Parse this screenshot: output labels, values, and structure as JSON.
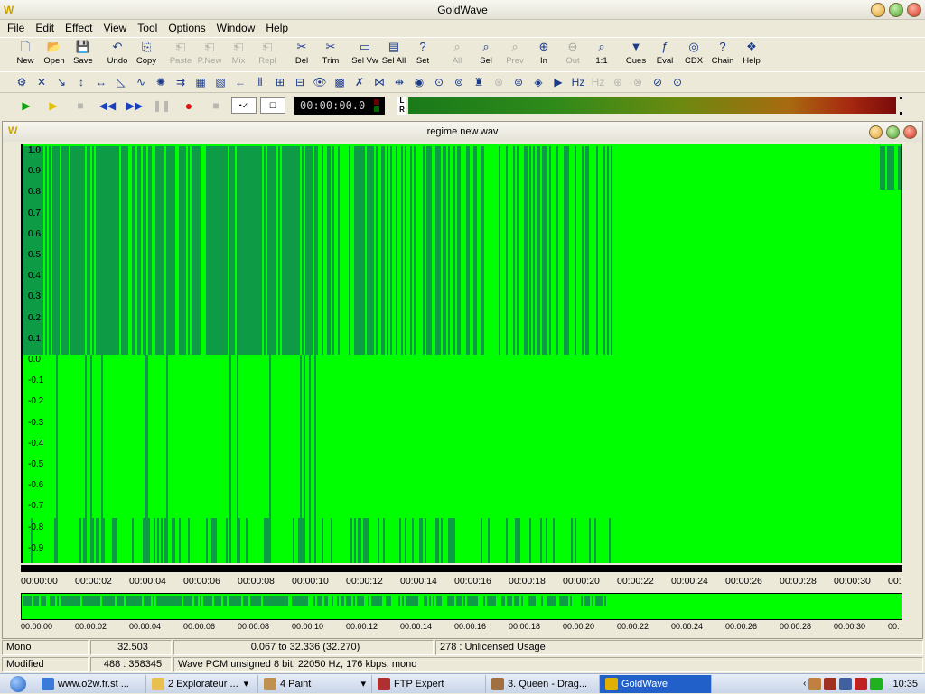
{
  "window": {
    "title": "GoldWave"
  },
  "menu": [
    "File",
    "Edit",
    "Effect",
    "View",
    "Tool",
    "Options",
    "Window",
    "Help"
  ],
  "toolbar": [
    {
      "label": "New",
      "icon": "new-icon",
      "enabled": true
    },
    {
      "label": "Open",
      "icon": "open-icon",
      "enabled": true
    },
    {
      "label": "Save",
      "icon": "save-icon",
      "enabled": true
    },
    {
      "label": "Undo",
      "icon": "undo-icon",
      "enabled": true
    },
    {
      "label": "Copy",
      "icon": "copy-icon",
      "enabled": true
    },
    {
      "label": "Paste",
      "icon": "paste-icon",
      "enabled": false
    },
    {
      "label": "P.New",
      "icon": "paste-new-icon",
      "enabled": false
    },
    {
      "label": "Mix",
      "icon": "mix-icon",
      "enabled": false
    },
    {
      "label": "Repl",
      "icon": "replace-icon",
      "enabled": false
    },
    {
      "label": "Del",
      "icon": "delete-icon",
      "enabled": true
    },
    {
      "label": "Trim",
      "icon": "trim-icon",
      "enabled": true
    },
    {
      "label": "Sel Vw",
      "icon": "select-view-icon",
      "enabled": true
    },
    {
      "label": "Sel All",
      "icon": "select-all-icon",
      "enabled": true
    },
    {
      "label": "Set",
      "icon": "set-icon",
      "enabled": true
    },
    {
      "label": "All",
      "icon": "zoom-all-icon",
      "enabled": false
    },
    {
      "label": "Sel",
      "icon": "zoom-select-icon",
      "enabled": true
    },
    {
      "label": "Prev",
      "icon": "zoom-prev-icon",
      "enabled": false
    },
    {
      "label": "In",
      "icon": "zoom-in-icon",
      "enabled": true
    },
    {
      "label": "Out",
      "icon": "zoom-out-icon",
      "enabled": false
    },
    {
      "label": "1:1",
      "icon": "zoom-1to1-icon",
      "enabled": true
    },
    {
      "label": "Cues",
      "icon": "cues-icon",
      "enabled": true
    },
    {
      "label": "Eval",
      "icon": "eval-icon",
      "enabled": true
    },
    {
      "label": "CDX",
      "icon": "cdx-icon",
      "enabled": true
    },
    {
      "label": "Chain",
      "icon": "chain-icon",
      "enabled": true
    },
    {
      "label": "Help",
      "icon": "help-book-icon",
      "enabled": true
    }
  ],
  "transport": {
    "time": "00:00:00.0",
    "channels": "L\nR"
  },
  "document": {
    "title": "regime new.wav",
    "amplitude_labels": [
      "1.0",
      "0.9",
      "0.8",
      "0.7",
      "0.6",
      "0.5",
      "0.4",
      "0.3",
      "0.2",
      "0.1",
      "0.0",
      "-0.1",
      "-0.2",
      "-0.3",
      "-0.4",
      "-0.5",
      "-0.6",
      "-0.7",
      "-0.8",
      "-0.9"
    ],
    "timeline": [
      "00:00:00",
      "00:00:02",
      "00:00:04",
      "00:00:06",
      "00:00:08",
      "00:00:10",
      "00:00:12",
      "00:00:14",
      "00:00:16",
      "00:00:18",
      "00:00:20",
      "00:00:22",
      "00:00:24",
      "00:00:26",
      "00:00:28",
      "00:00:30",
      "00:"
    ]
  },
  "status": {
    "channel": "Mono",
    "length": "32.503",
    "selection": "0.067 to 32.336 (32.270)",
    "license": "278 : Unlicensed Usage",
    "state": "Modified",
    "zoom": "488 : 358345",
    "format": "Wave PCM unsigned 8 bit, 22050 Hz, 176 kbps, mono"
  },
  "taskbar": {
    "tasks": [
      {
        "label": "www.o2w.fr.st ...",
        "icon": "ie-icon",
        "active": false
      },
      {
        "label": "2 Explorateur ...",
        "icon": "folder-icon",
        "active": false
      },
      {
        "label": "4 Paint",
        "icon": "paint-icon",
        "active": false
      },
      {
        "label": "FTP Expert",
        "icon": "ftp-icon",
        "active": false
      },
      {
        "label": "3. Queen - Drag...",
        "icon": "media-icon",
        "active": false
      },
      {
        "label": "GoldWave",
        "icon": "goldwave-icon",
        "active": true
      }
    ],
    "clock": "10:35"
  },
  "colors": {
    "waveform_bg": "#00ff00",
    "waveform_line": "#1a3a8a",
    "taskbar_active": "#2060c8"
  }
}
